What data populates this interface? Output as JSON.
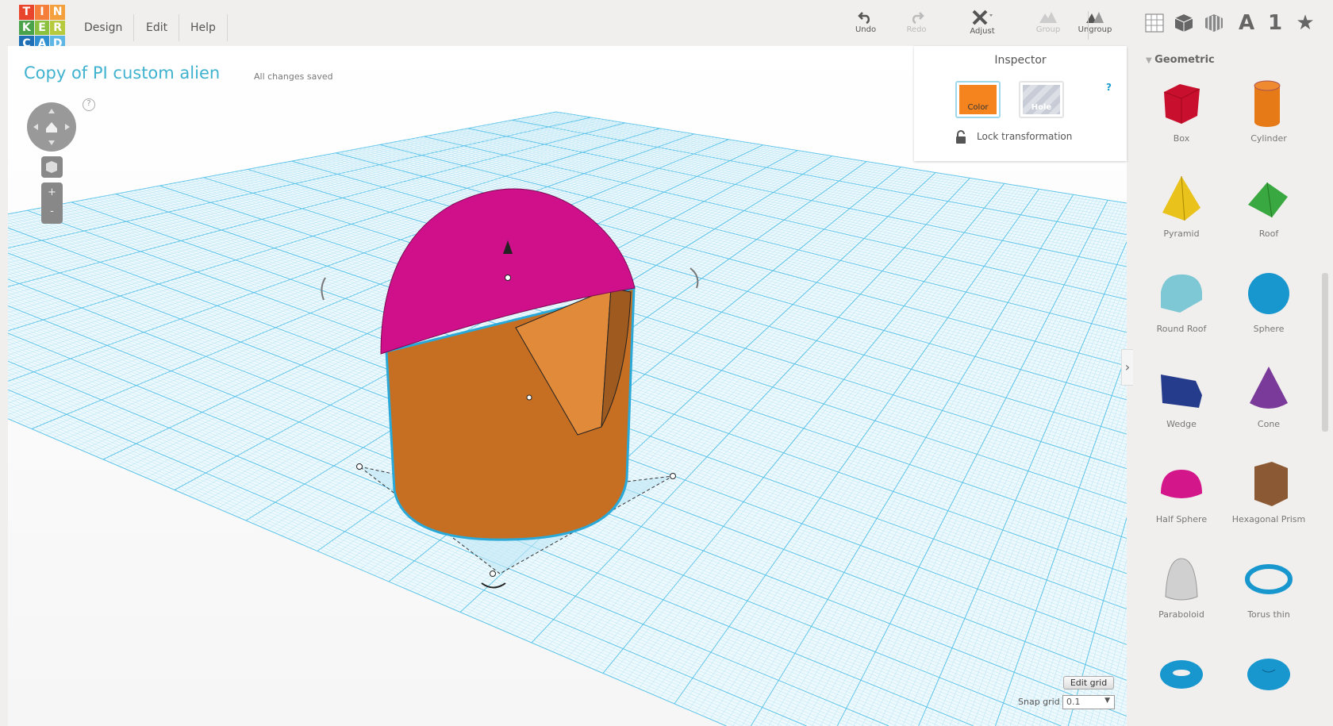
{
  "logo": {
    "letters": [
      "T",
      "I",
      "N",
      "K",
      "E",
      "R",
      "C",
      "A",
      "D"
    ],
    "colors": [
      "#e8452c",
      "#f47e3a",
      "#f4a03c",
      "#4aa24a",
      "#8cc13f",
      "#b7c93c",
      "#1f6fb4",
      "#2f8fd0",
      "#5db6e4"
    ]
  },
  "menu": [
    "Design",
    "Edit",
    "Help"
  ],
  "toolbar": {
    "undo": "Undo",
    "redo": "Redo",
    "adjust": "Adjust",
    "group": "Group",
    "ungroup": "Ungroup",
    "view_icons": [
      "grid-view-icon",
      "box-view-icon",
      "shape-generator-icon",
      "text-icon",
      "number-icon",
      "star-icon"
    ],
    "text_glyph": "A",
    "number_glyph": "1",
    "star_glyph": "★"
  },
  "design": {
    "title": "Copy of PI custom alien",
    "status": "All changes saved",
    "help": "?"
  },
  "inspector": {
    "title": "Inspector",
    "color_label": "Color",
    "hole_label": "Hole",
    "help": "?",
    "lock_label": "Lock transformation",
    "color": "#f5841f"
  },
  "panel": {
    "category": "Geometric",
    "items": [
      {
        "label": "Box",
        "color": "#c8102e"
      },
      {
        "label": "Cylinder",
        "color": "#e57a16"
      },
      {
        "label": "Pyramid",
        "color": "#e9c21c"
      },
      {
        "label": "Roof",
        "color": "#3aa840"
      },
      {
        "label": "Round Roof",
        "color": "#7ec8d6"
      },
      {
        "label": "Sphere",
        "color": "#1897cf"
      },
      {
        "label": "Wedge",
        "color": "#253b8c"
      },
      {
        "label": "Cone",
        "color": "#7a3a9a"
      },
      {
        "label": "Half Sphere",
        "color": "#d4168b"
      },
      {
        "label": "Hexagonal Prism",
        "color": "#8b5a34"
      },
      {
        "label": "Paraboloid",
        "color": "#d0d0d0"
      },
      {
        "label": "Torus thin",
        "color": "#1897cf"
      },
      {
        "label": "",
        "color": "#1897cf"
      },
      {
        "label": "",
        "color": "#1897cf"
      }
    ]
  },
  "grid": {
    "edit_label": "Edit grid",
    "snap_label": "Snap grid",
    "snap_value": "0.1"
  },
  "view": {
    "zoom_in": "+",
    "zoom_out": "-"
  }
}
